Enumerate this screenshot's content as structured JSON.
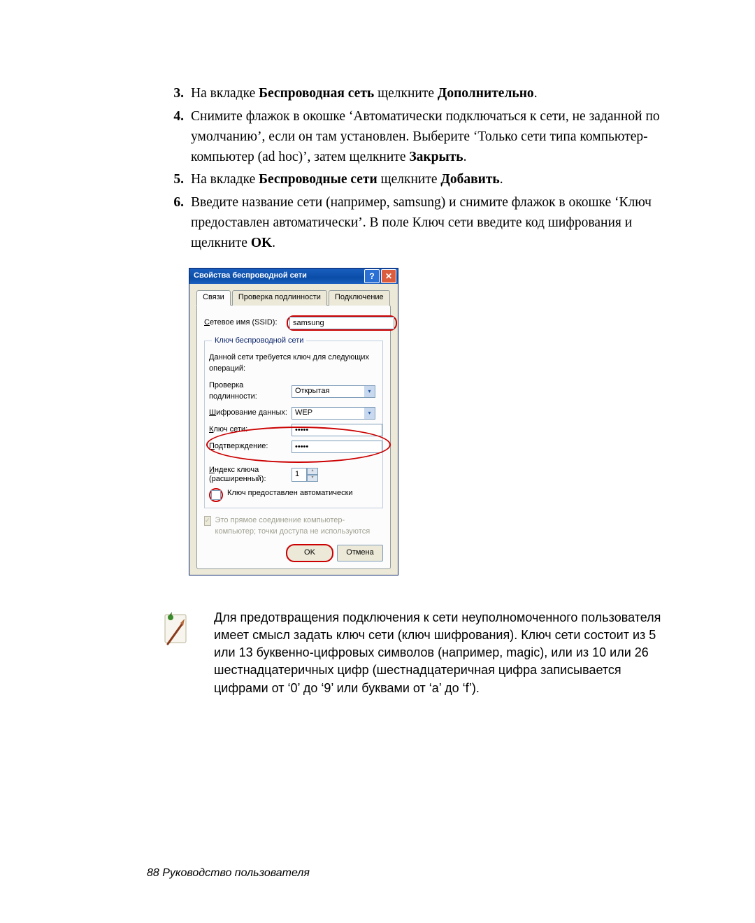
{
  "steps": [
    {
      "num": "3.",
      "segments": [
        {
          "text": "На вкладке ",
          "bold": false
        },
        {
          "text": "Беспроводная сеть",
          "bold": true
        },
        {
          "text": " щелкните ",
          "bold": false
        },
        {
          "text": "Дополнительно",
          "bold": true
        },
        {
          "text": ".",
          "bold": false
        }
      ]
    },
    {
      "num": "4.",
      "segments": [
        {
          "text": "Снимите флажок в окошке ‘Автоматически подключаться к сети, не заданной по умолчанию’, если он там установлен. Выберите ‘Только сети типа компьютер-компьютер (ad hoc)’, затем щелкните ",
          "bold": false
        },
        {
          "text": "Закрыть",
          "bold": true
        },
        {
          "text": ".",
          "bold": false
        }
      ]
    },
    {
      "num": "5.",
      "segments": [
        {
          "text": "На вкладке ",
          "bold": false
        },
        {
          "text": "Беспроводные сети",
          "bold": true
        },
        {
          "text": " щелкните ",
          "bold": false
        },
        {
          "text": "Добавить",
          "bold": true
        },
        {
          "text": ".",
          "bold": false
        }
      ]
    },
    {
      "num": "6.",
      "segments": [
        {
          "text": "Введите название сети (например, samsung) и снимите флажок в окошке ‘Ключ предоставлен автоматически’. В поле Ключ сети введите код шифрования и щелкните ",
          "bold": false
        },
        {
          "text": "OK",
          "bold": true
        },
        {
          "text": ".",
          "bold": false
        }
      ]
    }
  ],
  "dialog": {
    "title": "Свойства беспроводной сети",
    "tabs": {
      "connection": "Связи",
      "auth": "Проверка подлинности",
      "link": "Подключение"
    },
    "ssid_label_prefix": "С",
    "ssid_label": "етевое имя (SSID):",
    "ssid_value": "samsung",
    "key_group": "Ключ беспроводной сети",
    "key_desc": "Данной сети требуется ключ для следующих операций:",
    "auth_label": "Проверка подлинности:",
    "auth_value": "Открытая",
    "enc_label_prefix": "Ш",
    "enc_label": "ифрование данных:",
    "enc_value": "WEP",
    "key_label_prefix": "К",
    "key_label": "люч сети:",
    "key_value": "•••••",
    "confirm_label_prefix": "П",
    "confirm_label": "одтверждение:",
    "confirm_value": "•••••",
    "index_label_prefix": "И",
    "index_label": "ндекс ключа (расширенный):",
    "index_value": "1",
    "auto_key_label": "Ключ предоставлен автоматически",
    "adhoc_label": "Это прямое соединение компьютер-компьютер; точки доступа не используются",
    "ok": "OK",
    "cancel": "Отмена"
  },
  "note": "Для предотвращения подключения к сети неуполномоченного пользователя имеет смысл задать ключ сети (ключ шифрования). Ключ сети состоит из 5 или 13 буквенно-цифровых символов (например, magic), или из 10 или 26 шестнадцатеричных цифр (шестнадцатеричная цифра записывается цифрами от ‘0’ до ‘9’ или буквами от ‘a’ до ‘f’).",
  "footer": "88  Руководство пользователя"
}
